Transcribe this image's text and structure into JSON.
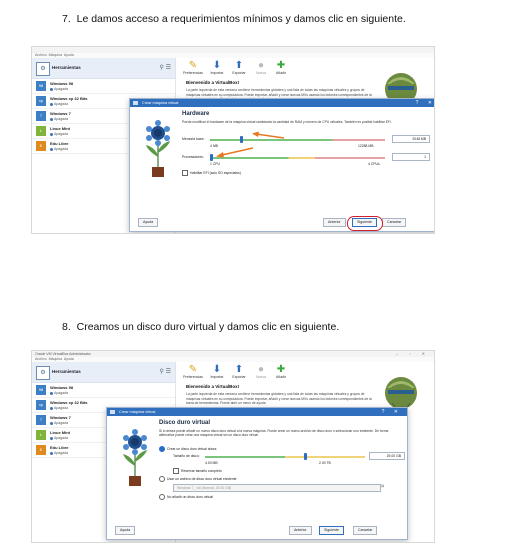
{
  "steps": [
    {
      "number": "7.",
      "text": "Le damos acceso a requerimientos mínimos y damos clic en siguiente."
    },
    {
      "number": "8.",
      "text": "Creamos un disco duro virtual y damos clic en siguiente."
    }
  ],
  "app": {
    "title": "Oracle VM VirtualBox Administrador",
    "menu": [
      "Archivo",
      "Máquina",
      "Ayuda"
    ],
    "tools_label": "Herramientas",
    "toolbar": [
      {
        "label": "Preferencias",
        "icon": "wrench-icon"
      },
      {
        "label": "Importar",
        "icon": "import-icon"
      },
      {
        "label": "Exportar",
        "icon": "export-icon"
      },
      {
        "label": "Nueva",
        "icon": "new-icon"
      },
      {
        "label": "Añadir",
        "icon": "add-icon"
      }
    ],
    "vms": [
      {
        "name": "Windows 98",
        "state": "Apagada"
      },
      {
        "name": "Windows xp 32 Bits",
        "state": "Apagada"
      },
      {
        "name": "Windows 7",
        "state": "Apagada"
      },
      {
        "name": "Linux Mint",
        "state": "Apagada"
      },
      {
        "name": "Edu Libre",
        "state": "Apagada"
      }
    ],
    "welcome_title": "Bienvenido a VirtualBox!",
    "welcome_text": "La parte izquierda de esta ventana contiene herramientas globales y una lista de todas las máquinas virtuales y grupos de máquinas virtuales en su computadora. Puede importar, añadir y crear nuevas MVs usando los botones correspondientes de la barra de herramientas. Puede abrir un menú de ayuda"
  },
  "dialog1": {
    "title": "Crear máquina virtual",
    "heading": "Hardware",
    "text": "Puede modificar el hardware de la máquina virtual cambiando la cantidad de RAM y número de CPU virtuales. También es posible habilitar EFI.",
    "memory_label": "Memoria base:",
    "memory_value": "2048 MB",
    "memory_min": "4 MB",
    "memory_max": "12288 MB",
    "memory_fraction": 0.17,
    "cpu_label": "Procesadores:",
    "cpu_value": "1",
    "cpu_min": "1 CPU",
    "cpu_max": "4 CPUs",
    "efi_label": "Habilitar EFI (solo SO especiales)",
    "buttons": {
      "help": "Ayuda",
      "back": "Anterior",
      "next": "Siguiente",
      "cancel": "Cancelar"
    }
  },
  "dialog2": {
    "title": "Crear máquina virtual",
    "heading": "Disco duro virtual",
    "text": "Si lo desea puede añadir un nuevo disco duro virtual a la nueva máquina. Puede crear un nuevo archivo de disco duro o seleccionar uno existente. De forma alternativa puede crear una máquina virtual sin un disco duro virtual.",
    "option_create": "Crear un disco duro virtual ahora",
    "size_label": "Tamaño de disco:",
    "size_value": "25.00 GB",
    "size_min": "4.00 MB",
    "size_max": "2.00 TB",
    "size_fraction": 0.62,
    "prealloc": "Reservar tamaño completo",
    "option_existing": "Usar un archivo de disco duro virtual existente",
    "existing_value": "Windows 7_ vdi (Normal, 25.00 GB)",
    "option_none": "No añadir un disco duro virtual",
    "buttons": {
      "help": "Ayuda",
      "back": "Anterior",
      "next": "Siguiente",
      "cancel": "Cancelar"
    }
  }
}
